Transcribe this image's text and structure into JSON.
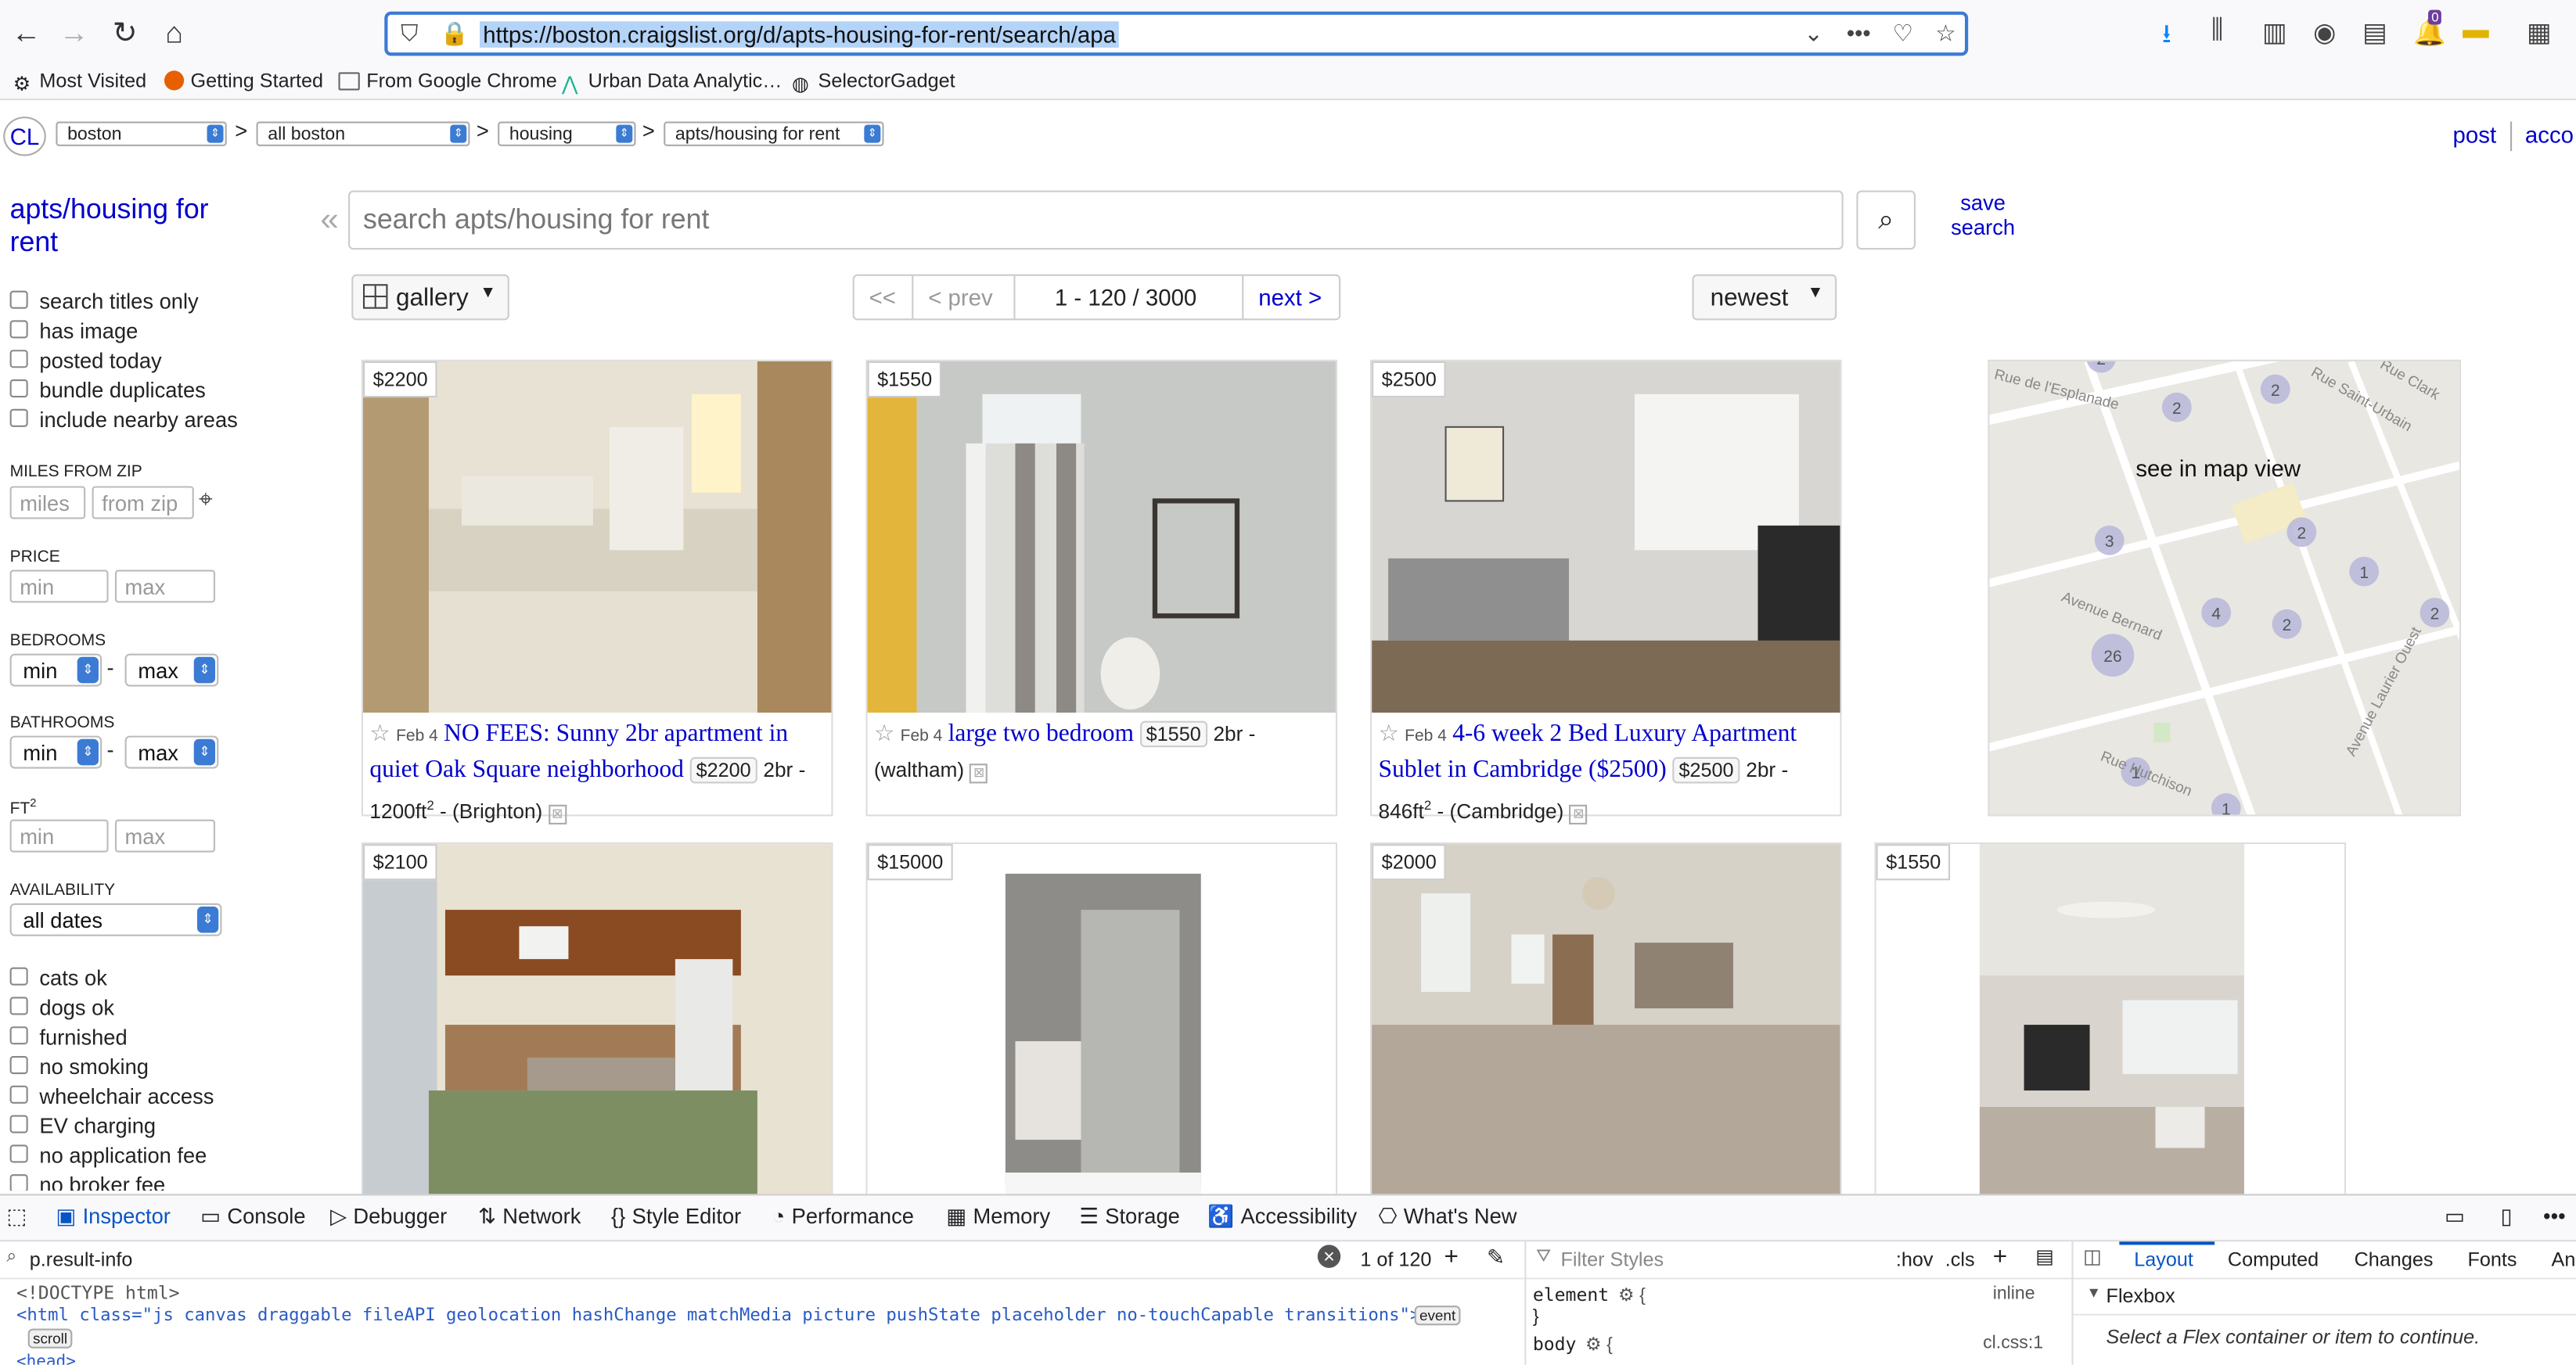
{
  "browser": {
    "url": "https://boston.craigslist.org/d/apts-housing-for-rent/search/apa",
    "bookmarks": [
      "Most Visited",
      "Getting Started",
      "From Google Chrome",
      "Urban Data Analytic…",
      "SelectorGadget"
    ],
    "notification_badge": "0"
  },
  "header": {
    "logo": "CL",
    "crumbs": [
      "boston",
      "all boston",
      "housing",
      "apts/housing for rent"
    ],
    "post": "post",
    "account": "acco"
  },
  "sidebar": {
    "title": "apts/housing for rent",
    "filters_top": [
      "search titles only",
      "has image",
      "posted today",
      "bundle duplicates",
      "include nearby areas"
    ],
    "miles_from_zip": {
      "label": "MILES FROM ZIP",
      "miles_ph": "miles",
      "zip_ph": "from zip"
    },
    "price": {
      "label": "PRICE",
      "min_ph": "min",
      "max_ph": "max"
    },
    "bedrooms": {
      "label": "BEDROOMS",
      "min": "min",
      "max": "max",
      "dash": "-"
    },
    "bathrooms": {
      "label": "BATHROOMS",
      "min": "min",
      "max": "max",
      "dash": "-"
    },
    "ft2": {
      "label": "FT",
      "sup": "2",
      "min_ph": "min",
      "max_ph": "max"
    },
    "availability": {
      "label": "AVAILABILITY",
      "value": "all dates"
    },
    "filters_bottom": [
      "cats ok",
      "dogs ok",
      "furnished",
      "no smoking",
      "wheelchair access",
      "EV charging",
      "no application fee",
      "no broker fee"
    ]
  },
  "search": {
    "placeholder": "search apts/housing for rent",
    "save_label_1": "save",
    "save_label_2": "search"
  },
  "toolbar": {
    "view": "gallery",
    "pager_first": "<<",
    "pager_prev": "< prev",
    "range": "1 - 120 / 3000",
    "pager_next": "next >",
    "sort": "newest"
  },
  "listings": [
    {
      "price": "$2200",
      "date": "Feb 4",
      "title": "NO FEES: Sunny 2br apartment in quiet Oak Square neighborhood",
      "chip": "$2200",
      "housing": "2br - 1200ft",
      "sup": "2",
      "location": " - (Brighton)"
    },
    {
      "price": "$1550",
      "date": "Feb 4",
      "title": "large two bedroom",
      "chip": "$1550",
      "housing": "2br - ",
      "sup": "",
      "location": "(waltham)"
    },
    {
      "price": "$2500",
      "date": "Feb 4",
      "title": "4-6 week 2 Bed Luxury Apartment Sublet in Cambridge ($2500)",
      "chip": "$2500",
      "housing": "2br - 846ft",
      "sup": "2",
      "location": " - (Cambridge)"
    },
    {
      "price": "$2100"
    },
    {
      "price": "$15000"
    },
    {
      "price": "$2000"
    },
    {
      "price": "$1550"
    }
  ],
  "map": {
    "label": "see in map view",
    "streets": [
      "Rue de l'Esplanade",
      "Rue Saint-Urbain",
      "Rue Clark",
      "Avenue Laurier Ouest",
      "Rue Hutchison",
      "Avenue Bernard"
    ],
    "clusters": [
      "2",
      "2",
      "2",
      "3",
      "1",
      "2",
      "4",
      "2",
      "26",
      "2",
      "1",
      "1"
    ]
  },
  "devtools": {
    "tabs": [
      "Inspector",
      "Console",
      "Debugger",
      "Network",
      "Style Editor",
      "Performance",
      "Memory",
      "Storage",
      "Accessibility",
      "What's New"
    ],
    "search_value": "p.result-info",
    "match_count": "1 of 120",
    "filter_styles_ph": "Filter Styles",
    "hov": ":hov",
    "cls": ".cls",
    "side_tabs": [
      "Layout",
      "Computed",
      "Changes",
      "Fonts",
      "An"
    ],
    "html_line1": "<!DOCTYPE html>",
    "html_line2": "<html class=\"js canvas draggable fileAPI geolocation hashChange matchMedia picture pushState placeholder no-touchCapable transitions\">",
    "event_badge": "event",
    "scroll_badge": "scroll",
    "html_line3": "<head>",
    "rule1_sel": "element",
    "rule1_src": "inline",
    "rule2_sel": "body",
    "rule2_src": "cl.css:1",
    "flexbox_title": "Flexbox",
    "flexbox_msg": "Select a Flex container or item to continue."
  },
  "colors": {
    "link": "#0000cc",
    "accent": "#3b7bd4",
    "devtools_active": "#0a55c4"
  }
}
